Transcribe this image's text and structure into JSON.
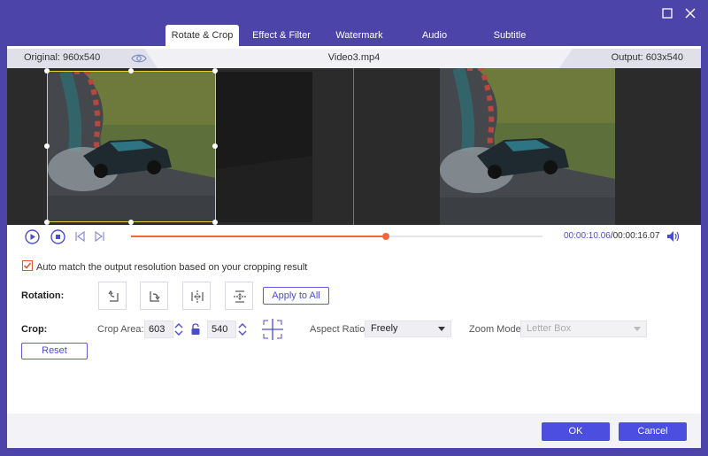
{
  "tabs": [
    {
      "label": "Rotate & Crop",
      "active": true
    },
    {
      "label": "Effect & Filter",
      "active": false
    },
    {
      "label": "Watermark",
      "active": false
    },
    {
      "label": "Audio",
      "active": false
    },
    {
      "label": "Subtitle",
      "active": false
    }
  ],
  "infobar": {
    "original": "Original: 960x540",
    "filename": "Video3.mp4",
    "output": "Output: 603x540"
  },
  "playback": {
    "current_time": "00:00:10.06",
    "total_time": "/00:00:16.07",
    "progress": 0.62
  },
  "settings": {
    "auto_match_label": "Auto match the output resolution based on your cropping result",
    "auto_match_checked": true,
    "rotation_label": "Rotation:",
    "apply_all_label": "Apply to All",
    "crop_label": "Crop:",
    "crop_area_label": "Crop Area:",
    "crop_width": "603",
    "crop_height": "540",
    "aspect_ratio_label": "Aspect Ratio:",
    "aspect_ratio_value": "Freely",
    "zoom_mode_label": "Zoom Mode:",
    "zoom_mode_value": "Letter Box",
    "reset_label": "Reset"
  },
  "footer": {
    "ok_label": "OK",
    "cancel_label": "Cancel"
  },
  "icons": {
    "maximize": "maximize-icon",
    "close": "close-icon",
    "eye": "eye-icon",
    "play": "play-icon",
    "stop": "stop-icon",
    "prev_frame": "previous-frame-icon",
    "next_frame": "next-frame-icon",
    "volume": "volume-icon",
    "rotate_left": "rotate-left-icon",
    "rotate_right": "rotate-right-icon",
    "flip_horizontal": "flip-horizontal-icon",
    "flip_vertical": "flip-vertical-icon",
    "lock": "lock-icon",
    "center": "center-crop-icon"
  },
  "colors": {
    "frame": "#4c44a8",
    "accent": "#4c4ee0",
    "progress": "#f2663b",
    "crop_border": "#e5d23a"
  }
}
